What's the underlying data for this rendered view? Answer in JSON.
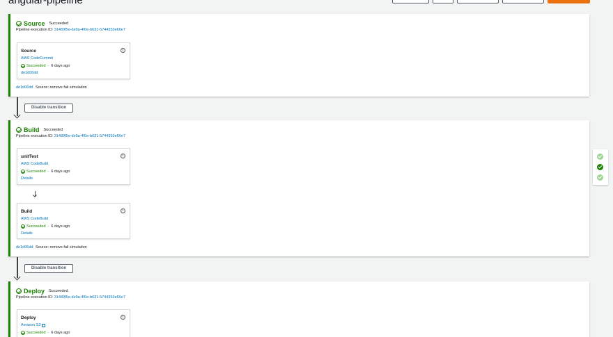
{
  "page": {
    "title": "angular-pipeline"
  },
  "stages": [
    {
      "name": "Source",
      "status": "Succeeded",
      "exec_label": "Pipeline execution ID:",
      "exec_id": "31489f5e-de9a-4f0e-b631-5744353e66e7",
      "actions": [
        {
          "name": "Source",
          "provider": "AWS CodeCommit",
          "status": "Succeeded",
          "time": "6 days ago",
          "extra": "de1d06dd"
        }
      ],
      "commit": {
        "id": "de1d06dd",
        "message": "Source: remove fail simulation"
      }
    },
    {
      "name": "Build",
      "status": "Succeeded",
      "exec_label": "Pipeline execution ID:",
      "exec_id": "31489f5e-de9a-4f0e-b631-5744353e66e7",
      "actions": [
        {
          "name": "unitTest",
          "provider": "AWS CodeBuild",
          "status": "Succeeded",
          "time": "6 days ago",
          "extra": "Details"
        },
        {
          "name": "Build",
          "provider": "AWS CodeBuild",
          "status": "Succeeded",
          "time": "6 days ago",
          "extra": "Details"
        }
      ],
      "commit": {
        "id": "de1d06dd",
        "message": "Source: remove fail simulation"
      }
    },
    {
      "name": "Deploy",
      "status": "Succeeded",
      "exec_label": "Pipeline execution ID:",
      "exec_id": "31489f5e-de9a-4f0e-b631-5744353e66e7",
      "actions": [
        {
          "name": "Deploy",
          "provider": "Amazon S3",
          "status": "Succeeded",
          "time": "6 days ago"
        }
      ]
    }
  ],
  "transitions": [
    {
      "label": "Disable transition"
    },
    {
      "label": "Disable transition"
    }
  ],
  "colors": {
    "success": "#1d8102",
    "link": "#0073bb",
    "primary": "#ec7211"
  },
  "icons": {
    "stage_status": "check-circle-icon",
    "info": "info-icon",
    "external": "external-link-icon"
  }
}
